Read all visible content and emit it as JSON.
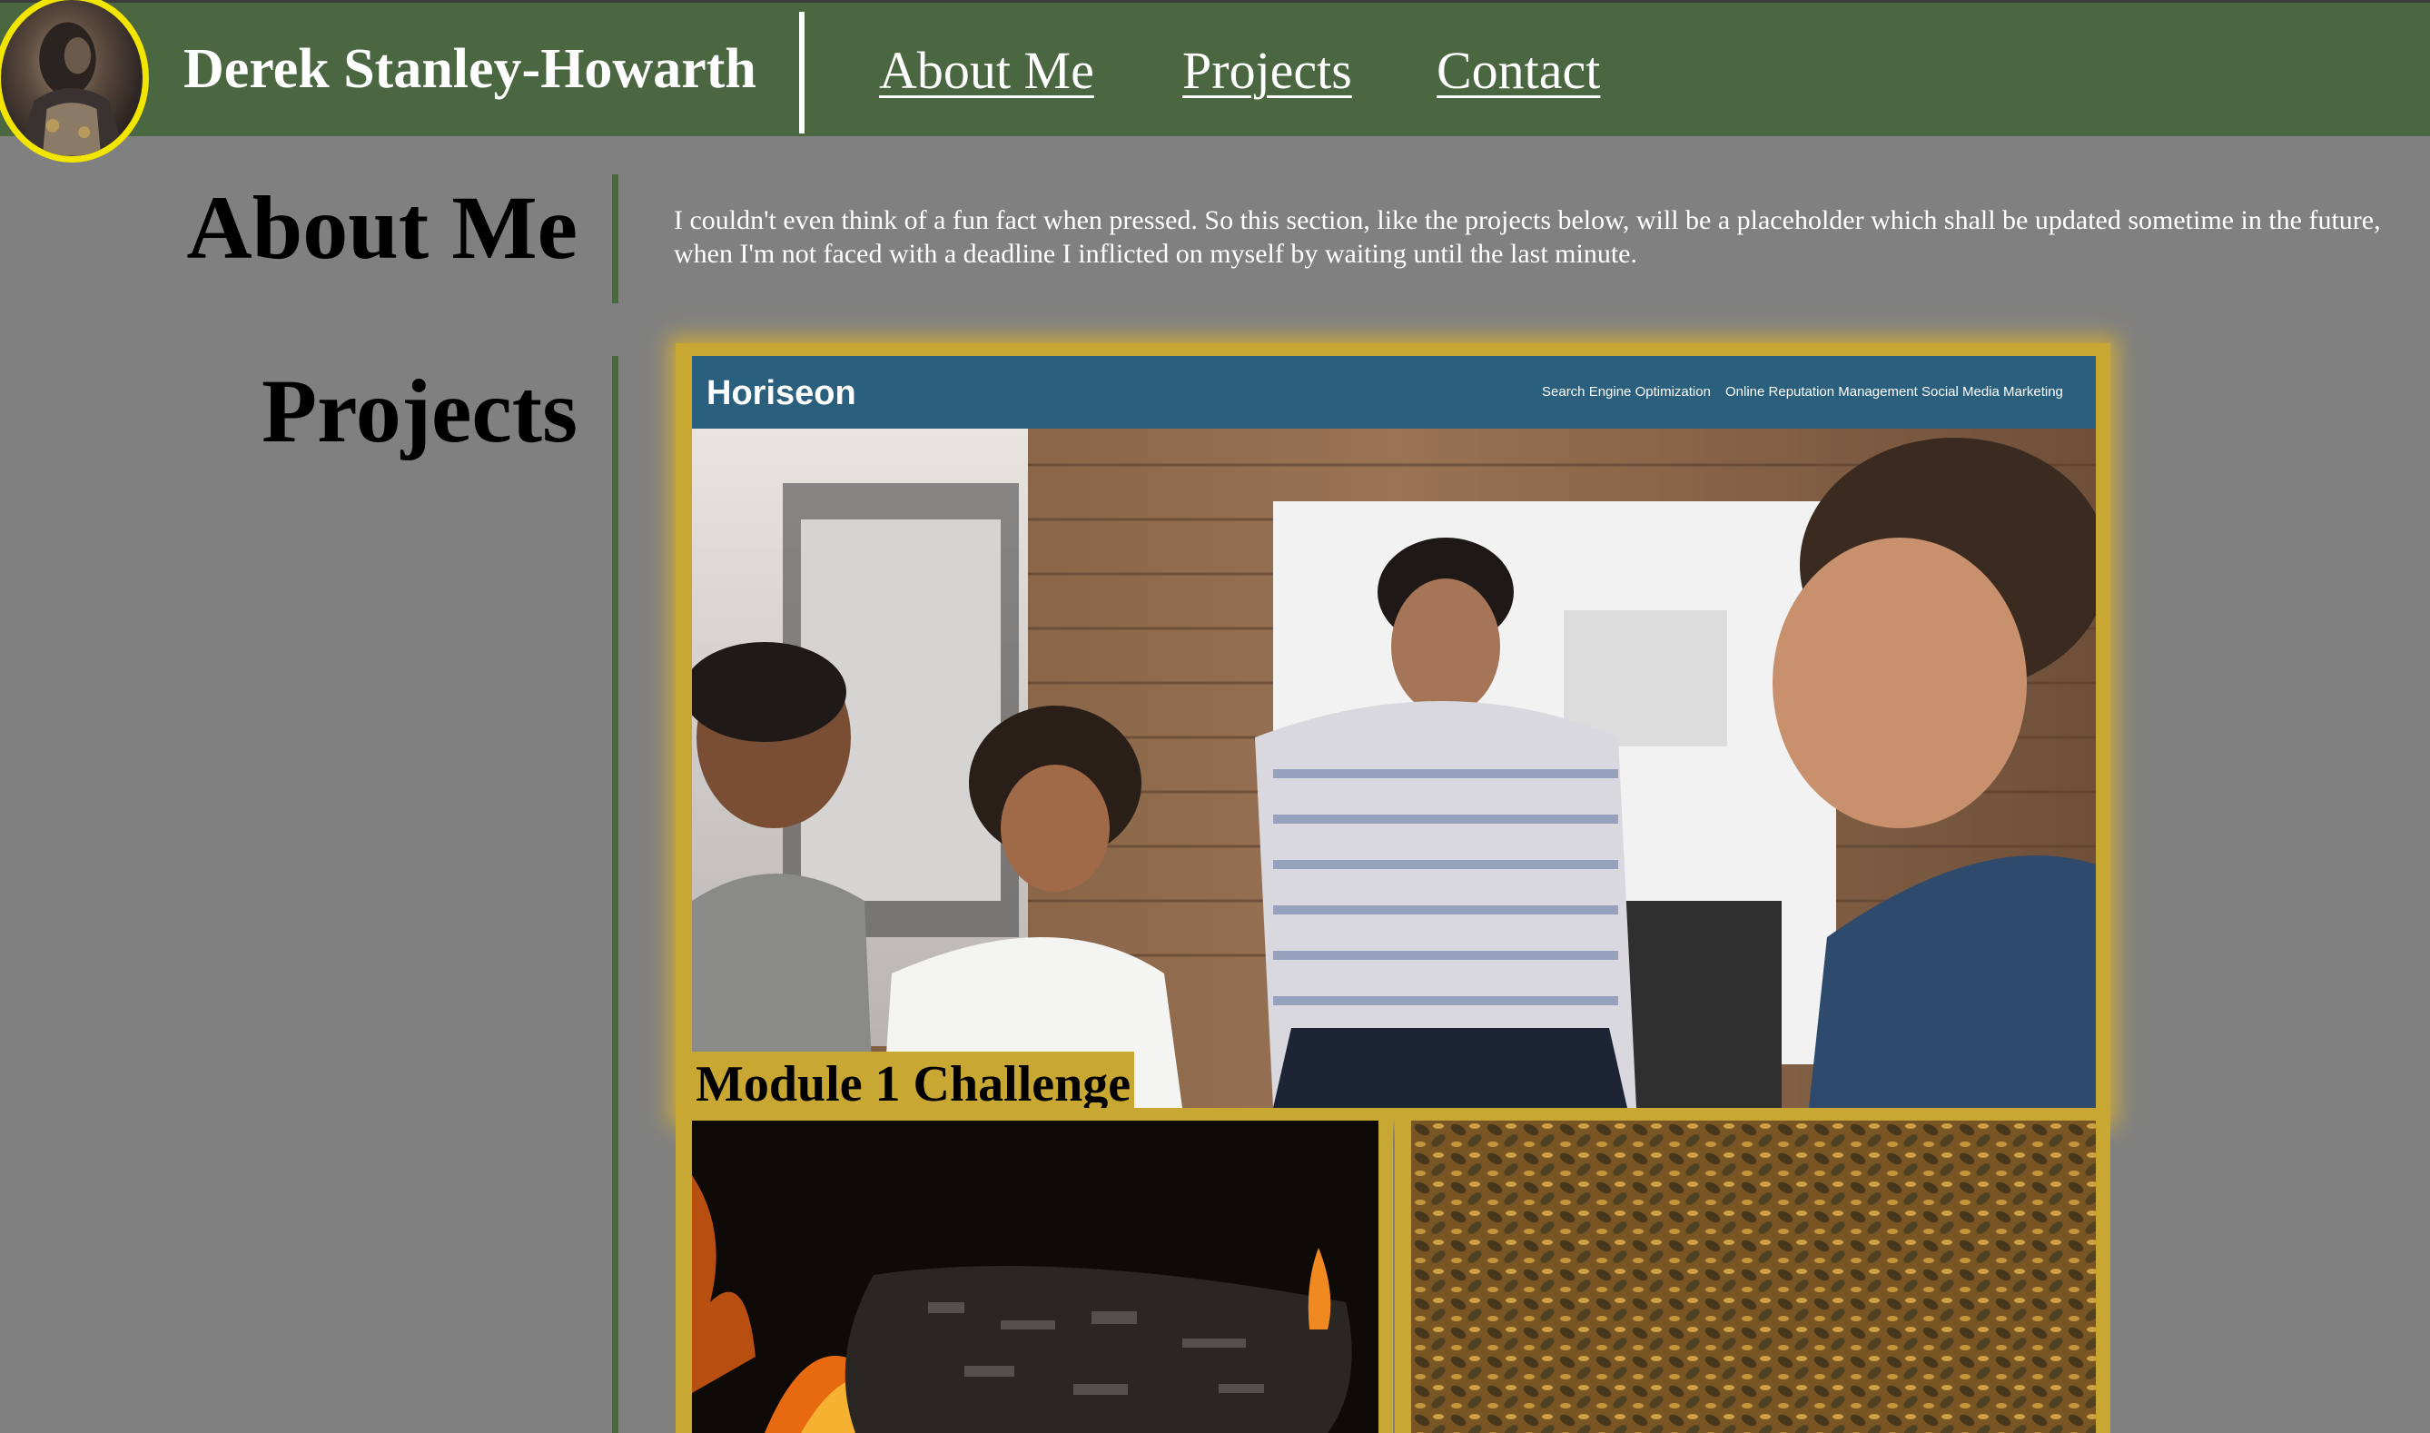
{
  "header": {
    "site_name": "Derek Stanley-Howarth",
    "nav": [
      "About Me",
      "Projects",
      "Contact"
    ]
  },
  "about": {
    "title": "About Me",
    "text": "I couldn't even think of a fun fact when pressed. So this section, like the projects below, will be a placeholder which shall be updated sometime in the future, when I'm not faced with a deadline I inflicted on myself by waiting until the last minute."
  },
  "projects": {
    "title": "Projects",
    "featured": {
      "label": "Module 1 Challenge",
      "screenshot": {
        "logo": "Horiseon",
        "nav": [
          "Search Engine Optimization",
          "Online Reputation Management",
          "Social Media Marketing"
        ]
      }
    }
  },
  "colors": {
    "header_bg": "#4a6741",
    "page_bg": "#808080",
    "card_gold": "#c8a832",
    "avatar_ring": "#f2e600",
    "horiseon_bar": "#2a5f7d"
  }
}
